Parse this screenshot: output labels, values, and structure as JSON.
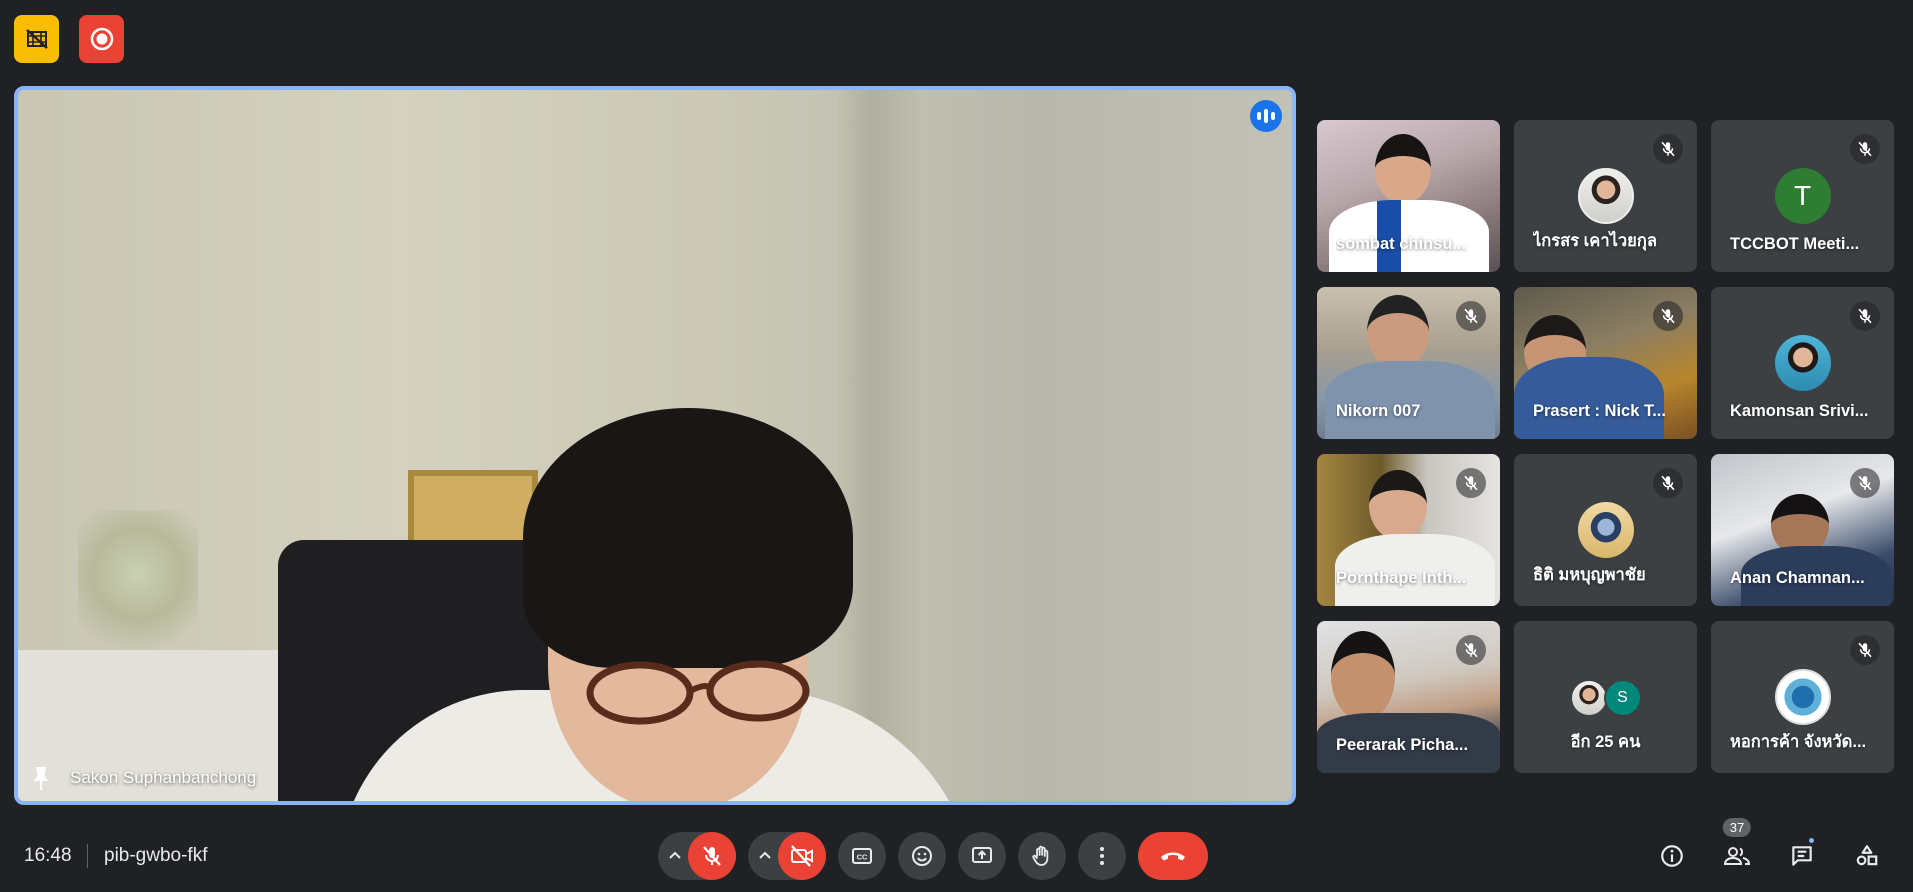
{
  "meeting": {
    "time": "16:48",
    "code": "pib-gwbo-fkf",
    "participant_count": "37"
  },
  "main_tile": {
    "name": "Sakon Suphanbanchong"
  },
  "tiles": [
    {
      "name": "sombat chinsu...",
      "muted": false
    },
    {
      "name": "ไกรสร เคาไวยกุล",
      "muted": true
    },
    {
      "name": "TCCBOT Meeti...",
      "muted": true,
      "letter": "T"
    },
    {
      "name": "Nikorn 007",
      "muted": true
    },
    {
      "name": "Prasert : Nick T...",
      "muted": true
    },
    {
      "name": "Kamonsan Srivi...",
      "muted": true
    },
    {
      "name": "Pornthape Inth...",
      "muted": true
    },
    {
      "name": "ธิติ มหบุญพาชัย",
      "muted": true
    },
    {
      "name": "Anan Chamnan...",
      "muted": true
    },
    {
      "name": "Peerarak Picha...",
      "muted": true
    },
    {
      "name": "อีก 25 คน",
      "muted": false,
      "avatar_letter": "S"
    },
    {
      "name": "หอการค้า จังหวัด...",
      "muted": true
    }
  ],
  "colors": {
    "background": "#202124",
    "tile": "#3c4043",
    "accent_blue": "#8ab4f8",
    "danger_red": "#ea4335",
    "warning_yellow": "#fbbc04"
  }
}
